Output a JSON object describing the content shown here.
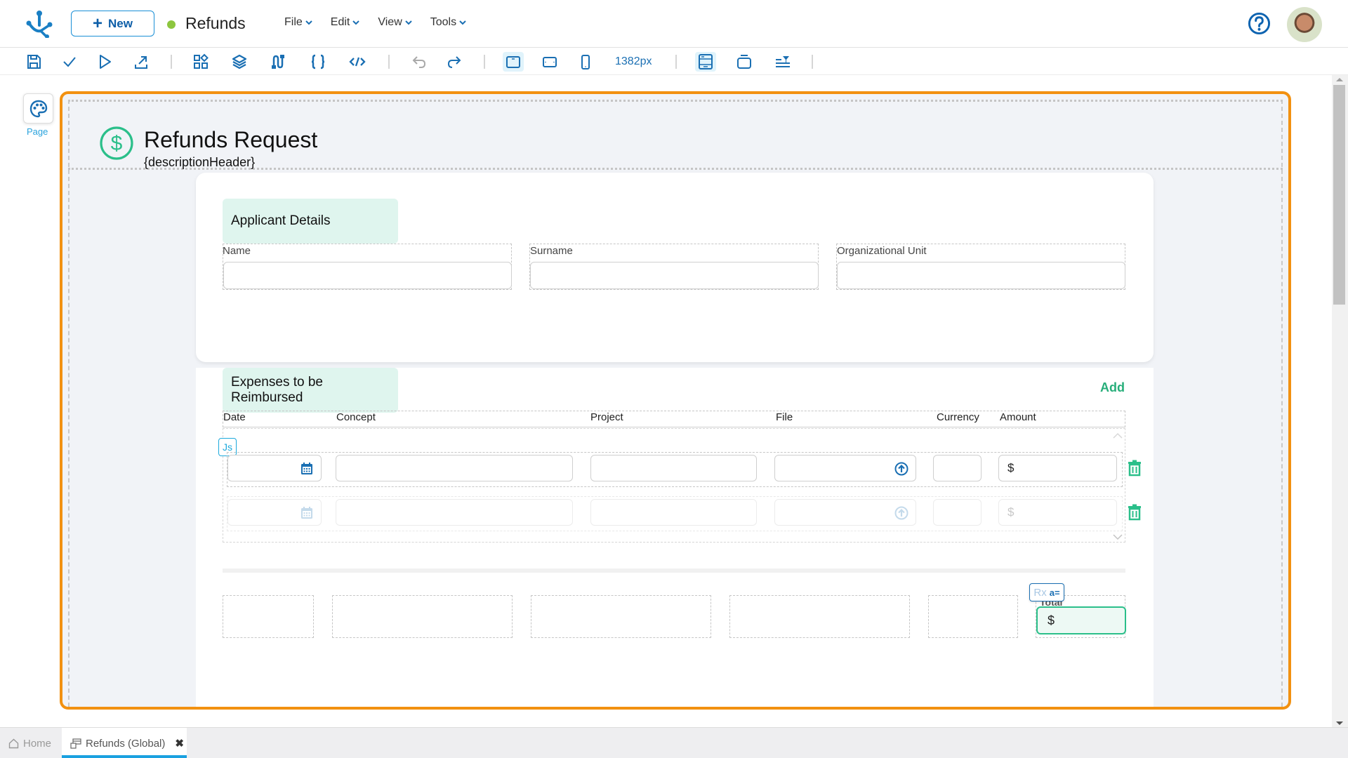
{
  "topbar": {
    "new_button": "New",
    "app_title": "Refunds",
    "status_color": "#8dc63f",
    "menus": [
      "File",
      "Edit",
      "View",
      "Tools"
    ]
  },
  "toolbar": {
    "icons": [
      "save-icon",
      "validate-check-icon",
      "run-play-icon",
      "publish-export-icon",
      "components-icon",
      "layers-icon",
      "flow-icon",
      "braces-code-icon",
      "html-code-icon",
      "undo-icon",
      "redo-icon",
      "desktop-view-icon",
      "tablet-view-icon",
      "mobile-view-icon",
      "layout-full-icon",
      "frame-icon",
      "align-filter-icon"
    ],
    "width_label": "1382px"
  },
  "left_panel": {
    "page_label": "Page"
  },
  "form": {
    "title": "Refunds Request",
    "description": "{descriptionHeader}",
    "applicant": {
      "section_title": "Applicant Details",
      "fields": [
        {
          "label": "Name",
          "value": ""
        },
        {
          "label": "Surname",
          "value": ""
        },
        {
          "label": "Organizational Unit",
          "value": ""
        }
      ]
    },
    "expenses": {
      "section_title": "Expenses to be Reimbursed",
      "add_label": "Add",
      "columns": [
        "Date",
        "Concept",
        "Project",
        "File",
        "Currency",
        "Amount"
      ],
      "rows": [
        {
          "date": "",
          "concept": "",
          "project": "",
          "file": "",
          "currency": "",
          "amount_prefix": "$"
        },
        {
          "date": "",
          "concept": "",
          "project": "",
          "file": "",
          "currency": "",
          "amount_prefix": "$"
        }
      ],
      "js_badge": "Js"
    },
    "total": {
      "label": "Total",
      "prefix": "$",
      "rx_badge": "Rx",
      "ax_badge": "a="
    }
  },
  "bottom_tabs": [
    {
      "label": "Home"
    },
    {
      "label": "Refunds (Global)"
    }
  ],
  "colors": {
    "accent_blue": "#1a6fb3",
    "accent_green": "#27ae7a",
    "selection_orange": "#f29111",
    "tab_indicator": "#1aa1e0"
  }
}
